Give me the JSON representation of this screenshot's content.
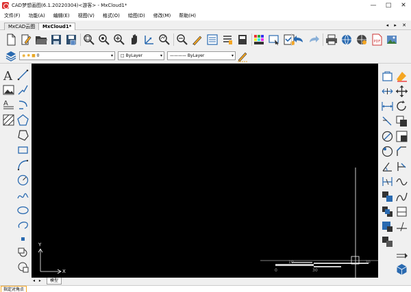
{
  "window": {
    "title": "CAD梦想画图(6.1.20220304)<游客> - MxCloud1*",
    "controls": [
      "—",
      "□",
      "✕"
    ]
  },
  "menu": [
    "文件(F)",
    "功能(A)",
    "编辑(E)",
    "视图(V)",
    "格式(O)",
    "绘图(D)",
    "修改(M)",
    "帮助(H)"
  ],
  "tabs": [
    {
      "label": "MxCAD云图",
      "active": false
    },
    {
      "label": "MxCloud1*",
      "active": true
    }
  ],
  "tab_controls": "◂ ▸ ✕",
  "layer_bar": {
    "layer_value": "0",
    "color_value": "ByLayer",
    "linetype_value": "ByLayer"
  },
  "canvas": {
    "axis_y_label": "Y",
    "axis_x_label": "X",
    "scale_labels": [
      "0",
      "10",
      "30",
      "70"
    ]
  },
  "model_tabs": {
    "nav": "◂ ▸",
    "model_label": "模型"
  },
  "status": {
    "prompt": "指定对角点"
  },
  "colors": {
    "accent_orange": "#f5a623",
    "canvas_bg": "#000000"
  }
}
